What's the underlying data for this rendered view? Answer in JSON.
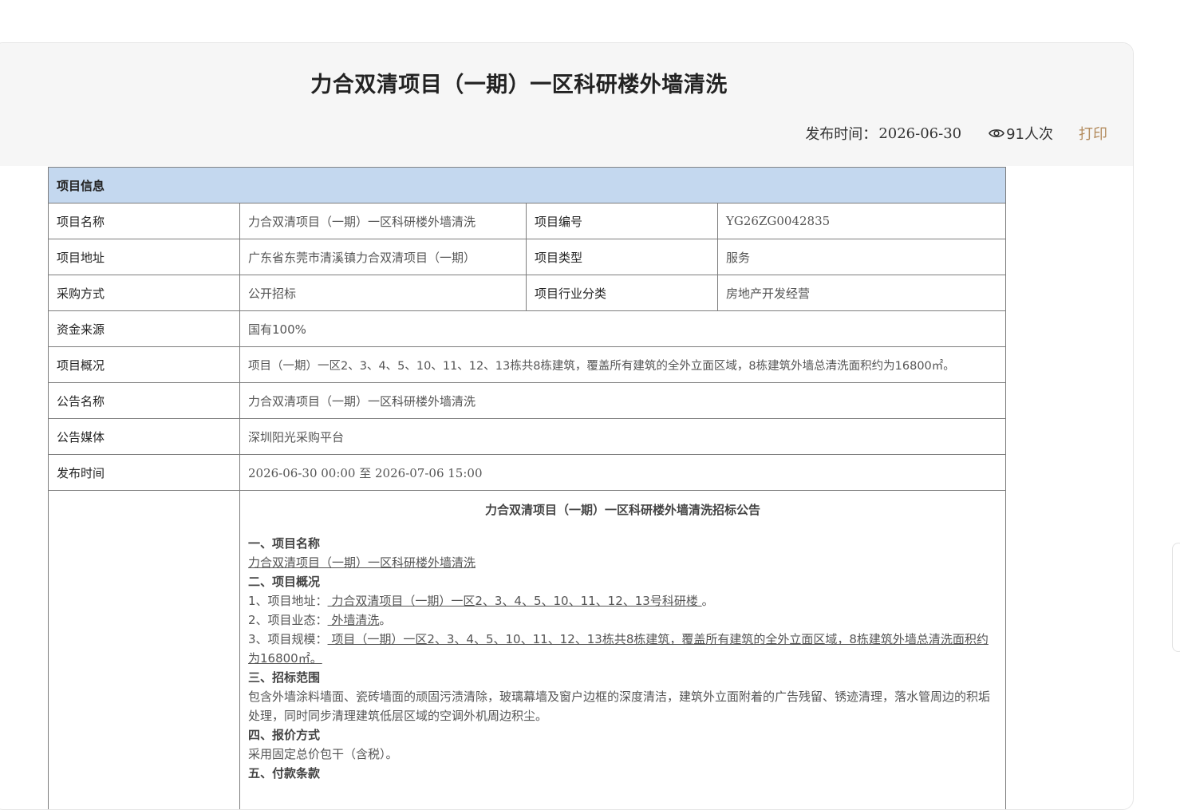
{
  "header": {
    "title": "力合双清项目（一期）一区科研楼外墙清洗",
    "publish_label": "发布时间：",
    "publish_date": "2026-06-30",
    "views": "91人次",
    "print_label": "打印"
  },
  "table": {
    "section_header": "项目信息",
    "rows": [
      {
        "l1": "项目名称",
        "v1": "力合双清项目（一期）一区科研楼外墙清洗",
        "l2": "项目编号",
        "v2": "YG26ZG0042835"
      },
      {
        "l1": "项目地址",
        "v1": "广东省东莞市清溪镇力合双清项目（一期）",
        "l2": "项目类型",
        "v2": "服务"
      },
      {
        "l1": "采购方式",
        "v1": "公开招标",
        "l2": "项目行业分类",
        "v2": "房地产开发经营"
      }
    ],
    "wide_rows": [
      {
        "l": "资金来源",
        "v": "国有100%"
      },
      {
        "l": "项目概况",
        "v": "项目（一期）一区2、3、4、5、10、11、12、13栋共8栋建筑，覆盖所有建筑的全外立面区域，8栋建筑外墙总清洗面积约为16800㎡。"
      },
      {
        "l": "公告名称",
        "v": "力合双清项目（一期）一区科研楼外墙清洗"
      },
      {
        "l": "公告媒体",
        "v": "深圳阳光采购平台"
      },
      {
        "l": "发布时间",
        "v": "2026-06-30 00:00 至 2026-07-06 15:00"
      }
    ]
  },
  "notice": {
    "title": "力合双清项目（一期）一区科研楼外墙清洗招标公告",
    "s1_title": "一、项目名称",
    "s1_body": "力合双清项目（一期）一区科研楼外墙清洗",
    "s2_title": "二、项目概况",
    "s2_addr_label": "1、项目地址：",
    "s2_addr_value": " 力合双清项目（一期）一区2、3、4、5、10、11、12、13号科研楼 ",
    "s2_type_label": "2、项目业态：",
    "s2_type_value": " 外墙清洗",
    "s2_scale_label": "3、项目规模：",
    "s2_scale_value": " 项目（一期）一区2、3、4、5、10、11、12、13栋共8栋建筑，覆盖所有建筑的全外立面区域，8栋建筑外墙总清洗面积约为16800㎡。",
    "s3_title": "三、招标范围",
    "s3_body": "包含外墙涂料墙面、瓷砖墙面的顽固污渍清除，玻璃幕墙及窗户边框的深度清洁，建筑外立面附着的广告残留、锈迹清理，落水管周边的积垢处理，同时同步清理建筑低层区域的空调外机周边积尘。",
    "s4_title": "四、报价方式",
    "s4_body": "采用固定总价包干（含税）。",
    "s5_title": "五、付款条款"
  }
}
